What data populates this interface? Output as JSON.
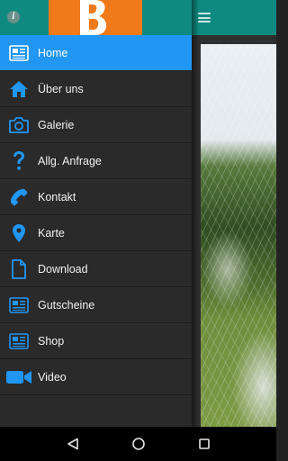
{
  "app": {
    "accent_color": "#0f8a80",
    "active_color": "#2196f3",
    "icon_color": "#2196f3",
    "logo_color": "#f07a1a"
  },
  "header": {
    "info_icon": "info-icon",
    "logo_icon": "brand-logo"
  },
  "menu": {
    "items": [
      {
        "label": "Home",
        "icon": "newspaper-icon",
        "active": true
      },
      {
        "label": "Über uns",
        "icon": "home-icon",
        "active": false
      },
      {
        "label": "Galerie",
        "icon": "camera-icon",
        "active": false
      },
      {
        "label": "Allg. Anfrage",
        "icon": "question-icon",
        "active": false
      },
      {
        "label": "Kontakt",
        "icon": "phone-icon",
        "active": false
      },
      {
        "label": "Karte",
        "icon": "map-pin-icon",
        "active": false
      },
      {
        "label": "Download",
        "icon": "document-icon",
        "active": false
      },
      {
        "label": "Gutscheine",
        "icon": "newspaper-icon",
        "active": false
      },
      {
        "label": "Shop",
        "icon": "newspaper-icon",
        "active": false
      },
      {
        "label": "Video",
        "icon": "video-camera-icon",
        "active": false
      }
    ]
  },
  "toolbar": {
    "menu_icon": "hamburger-icon"
  },
  "navbar": {
    "back_icon": "back-triangle-icon",
    "home_icon": "home-circle-icon",
    "recents_icon": "recents-square-icon"
  }
}
